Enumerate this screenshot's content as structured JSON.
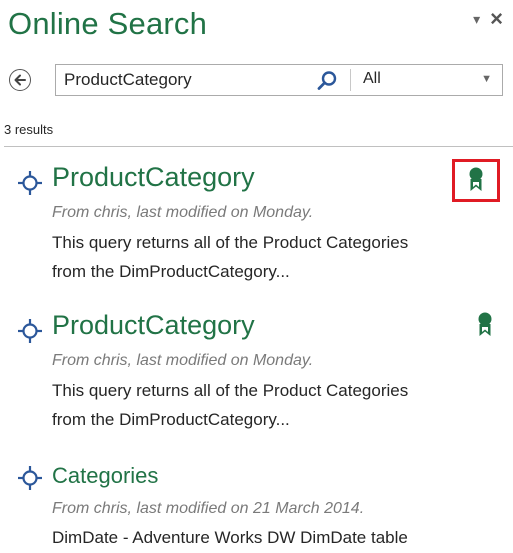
{
  "pane": {
    "title": "Online Search",
    "dropdown_glyph": "▾",
    "close_glyph": "×"
  },
  "search": {
    "value": "ProductCategory",
    "placeholder": "",
    "scope_selected": "All"
  },
  "results": {
    "count_label": "3 results",
    "items": [
      {
        "title": "ProductCategory",
        "meta": "From chris, last modified on Monday.",
        "desc_line1": "This query returns all of the Product Categories",
        "desc_line2": "from the DimProductCategory...",
        "certified": true
      },
      {
        "title": "ProductCategory",
        "meta": "From chris, last modified on Monday.",
        "desc_line1": "This query returns all of the Product Categories",
        "desc_line2": "from the DimProductCategory...",
        "certified": true
      },
      {
        "title": "Categories",
        "meta": "From chris, last modified on 21 March 2014.",
        "desc_line1": "DimDate - Adventure Works DW DimDate table",
        "desc_line2": "",
        "certified": false
      }
    ]
  },
  "icons": {
    "back": "back-arrow-icon",
    "search": "magnifier-icon",
    "result": "query-target-icon",
    "badge": "certified-ribbon-icon"
  },
  "colors": {
    "accent": "#217346",
    "highlight": "#e01b24",
    "meta_text": "#7a7a7a"
  }
}
